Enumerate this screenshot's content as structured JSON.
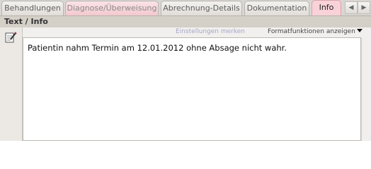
{
  "tabs": [
    {
      "label": "Behandlungen"
    },
    {
      "label": "Diagnose/Überweisung"
    },
    {
      "label": "Abrechnung-Details"
    },
    {
      "label": "Dokumentation"
    },
    {
      "label": "Info"
    }
  ],
  "section": {
    "title": "Text / Info"
  },
  "toolbar": {
    "settings_label": "Einstellungen merken",
    "format_label": "Formatfunktionen anzeigen"
  },
  "editor": {
    "text": "Patientin nahm Termin am 12.01.2012 ohne Absage nicht wahr."
  },
  "icons": {
    "prev": "chevron-left-icon",
    "next": "chevron-right-icon",
    "notepad": "notepad-pencil-icon",
    "dropdown": "chevron-down-icon"
  }
}
